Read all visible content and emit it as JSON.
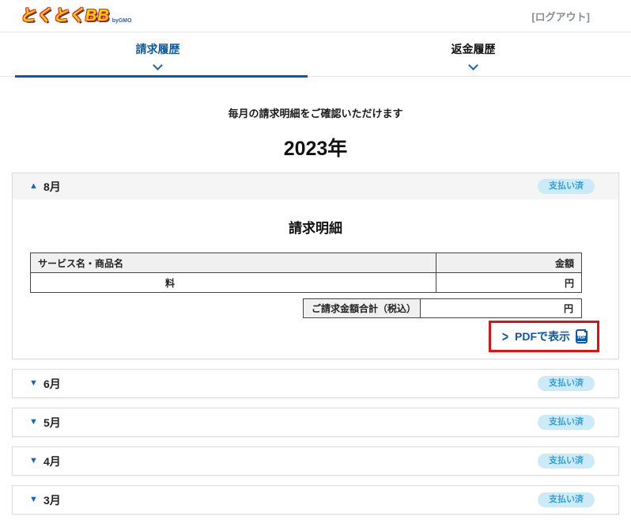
{
  "header": {
    "logo_text": "とくとくBB",
    "logo_sub": "byGMO",
    "logout_label": "[ログアウト]"
  },
  "tabs": [
    {
      "label": "請求履歴",
      "active": true
    },
    {
      "label": "返金履歴",
      "active": false
    }
  ],
  "intro": "毎月の請求明細をご確認いただけます",
  "year_heading": "2023年",
  "months": [
    {
      "label": "8月",
      "status": "支払い済",
      "marker": "▲",
      "expanded": true
    },
    {
      "label": "6月",
      "status": "支払い済",
      "marker": "▼",
      "expanded": false
    },
    {
      "label": "5月",
      "status": "支払い済",
      "marker": "▼",
      "expanded": false
    },
    {
      "label": "4月",
      "status": "支払い済",
      "marker": "▼",
      "expanded": false
    },
    {
      "label": "3月",
      "status": "支払い済",
      "marker": "▼",
      "expanded": false
    }
  ],
  "detail": {
    "title": "請求明細",
    "table": {
      "headers": [
        "サービス名・商品名",
        "金額"
      ],
      "rows": [
        [
          "料",
          "円"
        ]
      ]
    },
    "total_label": "ご請求金額合計（税込）",
    "total_value": "円",
    "pdf_link_prefix": ">",
    "pdf_link_label": "PDFで表示",
    "pdf_icon_label": "PDF"
  },
  "colors": {
    "accent_blue": "#0b5aa9",
    "marker_blue": "#1565c0",
    "badge_bg": "#cdeaf8",
    "badge_text": "#2ba2da",
    "highlight_red": "#dd1212"
  }
}
